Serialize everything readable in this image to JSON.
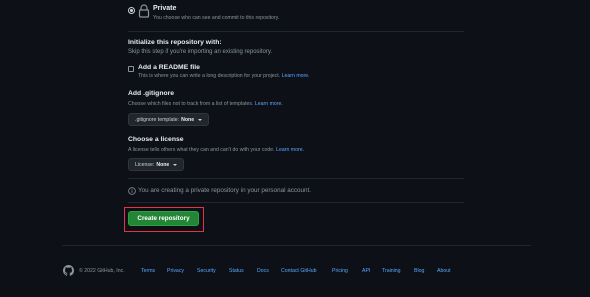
{
  "visibility": {
    "private_title": "Private",
    "private_desc": "You choose who can see and commit to this repository."
  },
  "initialize": {
    "title": "Initialize this repository with:",
    "subtitle": "Skip this step if you're importing an existing repository."
  },
  "readme": {
    "label": "Add a README file",
    "desc": "This is where you can write a long description for your project.",
    "learn_more": "Learn more."
  },
  "gitignore": {
    "title": "Add .gitignore",
    "desc": "Choose which files not to track from a list of templates.",
    "learn_more": "Learn more.",
    "select_prefix": ".gitignore template:",
    "select_value": "None"
  },
  "license": {
    "title": "Choose a license",
    "desc": "A license tells others what they can and can't do with your code.",
    "learn_more": "Learn more.",
    "select_prefix": "License:",
    "select_value": "None"
  },
  "info": {
    "text": "You are creating a private repository in your personal account."
  },
  "create_button": {
    "label": "Create repository"
  },
  "footer": {
    "copyright": "© 2022 GitHub, Inc.",
    "links": [
      "Terms",
      "Privacy",
      "Security",
      "Status",
      "Docs",
      "Contact GitHub",
      "Pricing",
      "API",
      "Training",
      "Blog",
      "About"
    ]
  },
  "colors": {
    "background": "#0d1117",
    "accent_link": "#58a6ff",
    "primary_button": "#238636",
    "highlight_box": "#e5343f"
  }
}
